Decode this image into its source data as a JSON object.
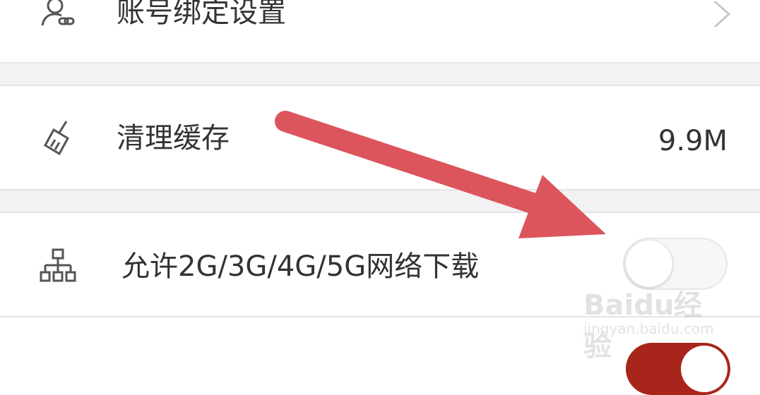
{
  "settings": {
    "items": [
      {
        "label": "账号绑定设置",
        "icon": "account-link-icon",
        "has_chevron": true
      },
      {
        "label": "清理缓存",
        "icon": "broom-icon",
        "value": "9.9M"
      },
      {
        "label": "允许2G/3G/4G/5G网络下载",
        "icon": "network-tree-icon",
        "toggle_on": false
      }
    ]
  },
  "watermark": {
    "brand": "Baidu经验",
    "url": "jingyan.baidu.com"
  },
  "annotation": {
    "color": "#dc555c",
    "icon": "red-arrow"
  },
  "colors": {
    "separator_bg": "#f2f2f2",
    "toggle_on": "#a8251b"
  }
}
